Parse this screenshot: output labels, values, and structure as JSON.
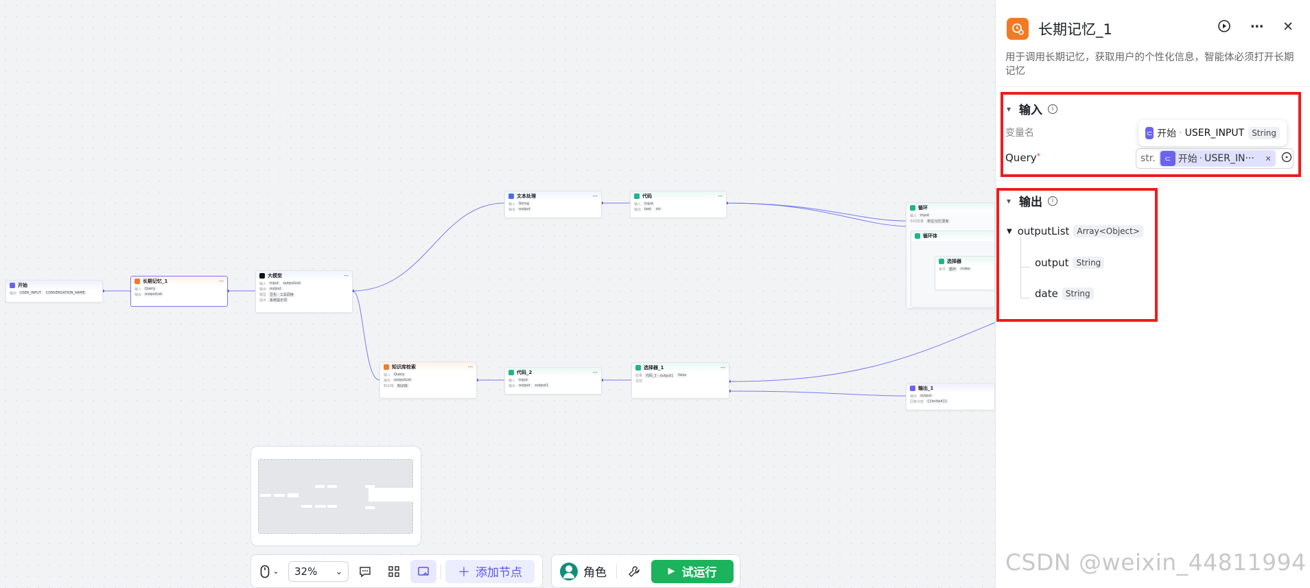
{
  "nodes": {
    "start": {
      "title": "开始",
      "r1": "USER_INPUT",
      "r2": "CONVERSATION_NAME"
    },
    "memory": {
      "title": "长期记忆_1",
      "r1": "Query",
      "r2": "outputList"
    },
    "llm": {
      "title": "大模型",
      "r1": "input",
      "r1b": "outputList",
      "r2": "output",
      "r3": "豆包 · 工具调用",
      "r4": "系统提示词"
    },
    "text": {
      "title": "文本处理",
      "r1": "String",
      "r2": "output"
    },
    "code": {
      "title": "代码",
      "r1": "input",
      "r2": "text",
      "r2b": "str"
    },
    "loop": {
      "title": "循环",
      "r1": "input",
      "r2": "单位/记忆更新"
    },
    "loopbody": {
      "title": "循环体"
    },
    "selector": {
      "title": "选择器",
      "r1": "循环",
      "r2": "index"
    },
    "kb": {
      "title": "知识库检索",
      "r1": "Query",
      "r2": "outputList",
      "r3": "知识库"
    },
    "code2": {
      "title": "代码_2",
      "r1": "input",
      "r2": "output",
      "r2b": "output1"
    },
    "selector1": {
      "title": "选择器_1",
      "r1": "代码_2 · output1",
      "r1b": "false"
    },
    "output1": {
      "title": "输出_1",
      "r1": "output",
      "r2": "{{output}}"
    }
  },
  "toolbar": {
    "zoom": "32%",
    "add_node": "添加节点",
    "role": "角色",
    "run": "试运行"
  },
  "panel": {
    "title": "长期记忆_1",
    "description": "用于调用长期记忆，获取用户的个性化信息，智能体必须打开长期记忆",
    "input_section": "输入",
    "var_name_header": "变量名",
    "tooltip_source": "开始",
    "tooltip_var": "USER_INPUT",
    "tooltip_type": "String",
    "query_label": "Query",
    "query_type_prefix": "str.",
    "query_value_source": "开始",
    "query_value_var": "USER_IN···",
    "output_section": "输出",
    "outputs": [
      {
        "name": "outputList",
        "type": "Array<Object>"
      },
      {
        "name": "output",
        "type": "String"
      },
      {
        "name": "date",
        "type": "String"
      }
    ]
  },
  "colors": {
    "accent": "#6b63f0",
    "run_green": "#1bb35b",
    "highlight_red": "#ee1c1c",
    "memory_orange": "#f27a25"
  },
  "watermark": "CSDN @weixin_44811994"
}
